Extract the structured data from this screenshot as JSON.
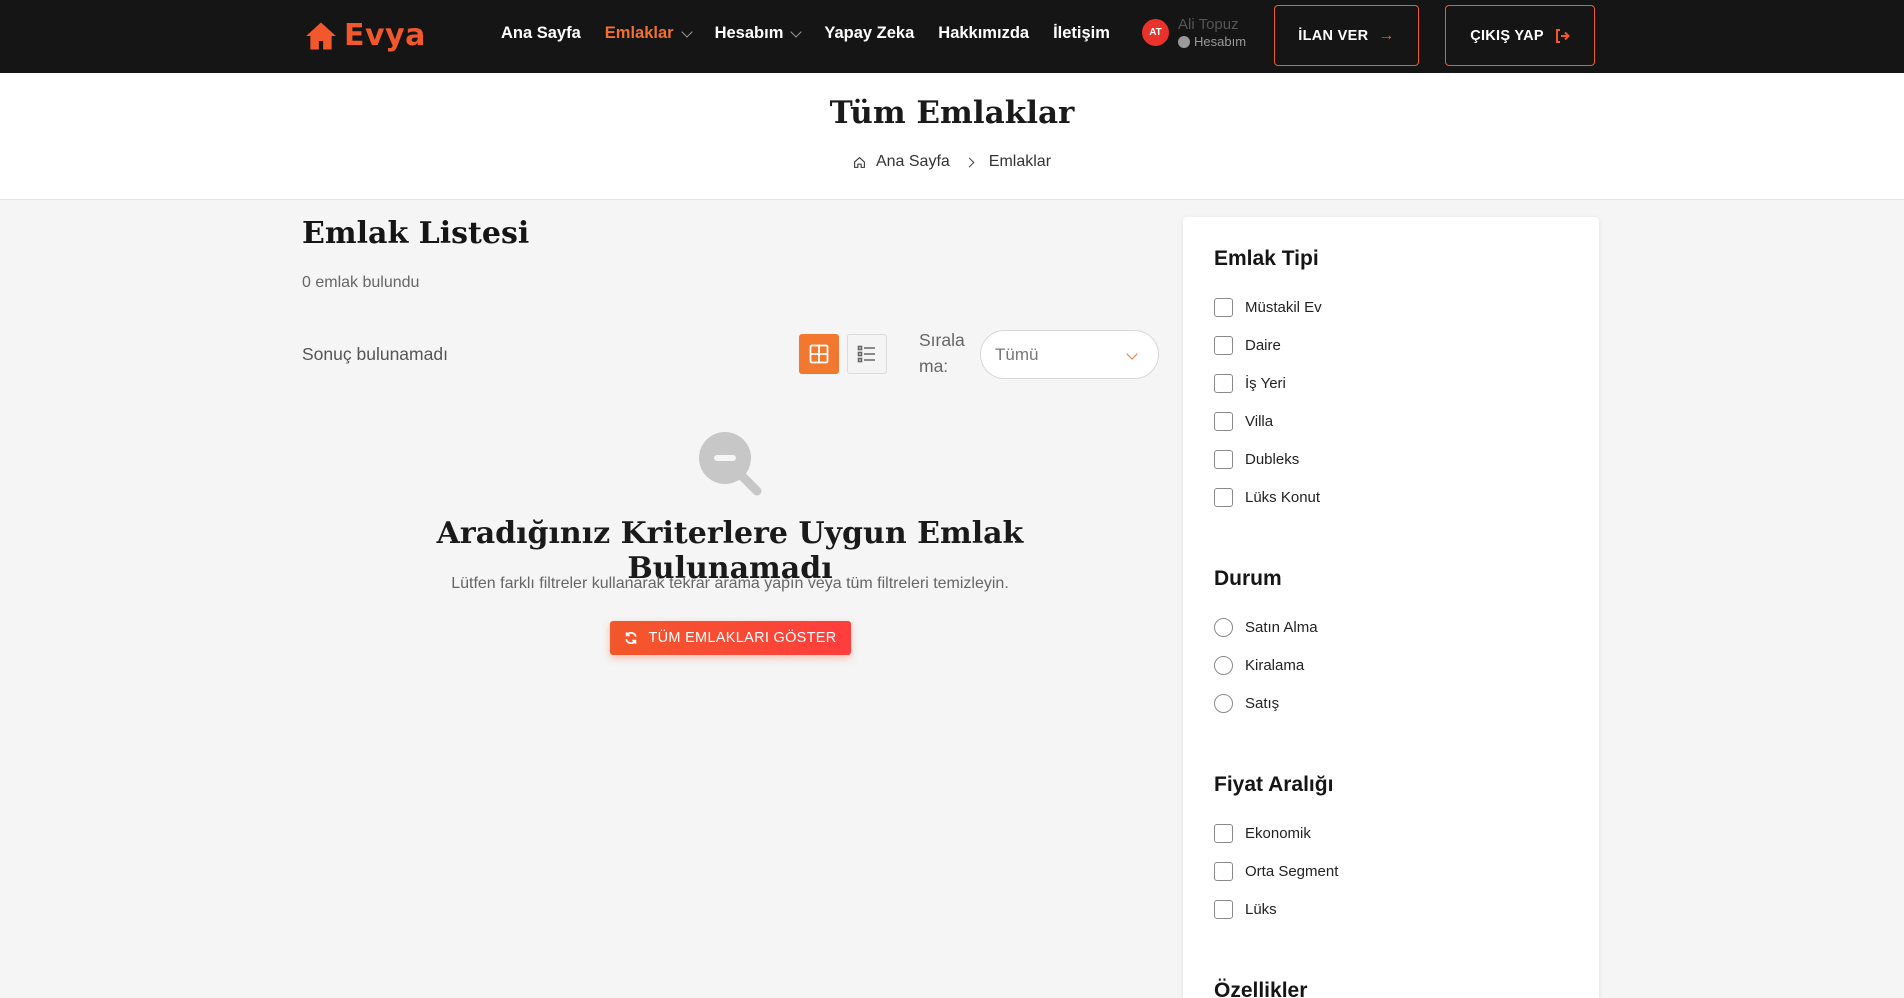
{
  "header": {
    "logo_text": "Evya",
    "nav": [
      {
        "label": "Ana Sayfa"
      },
      {
        "label": "Emlaklar"
      },
      {
        "label": "Hesabım"
      },
      {
        "label": "Yapay Zeka"
      },
      {
        "label": "Hakkımızda"
      },
      {
        "label": "İletişim"
      }
    ],
    "user": {
      "initials": "AT",
      "name": "Ali Topuz",
      "subtitle": "Hesabım"
    },
    "ilan_ver": "İLAN VER",
    "cikis_yap": "ÇIKIŞ YAP"
  },
  "page": {
    "title": "Tüm Emlaklar",
    "breadcrumb": {
      "home": "Ana Sayfa",
      "current": "Emlaklar"
    }
  },
  "listing": {
    "title": "Emlak Listesi",
    "count_text": "0 emlak bulundu",
    "no_result": "Sonuç bulunamadı",
    "sort_label": "Sıralama:",
    "sort_value": "Tümü"
  },
  "empty": {
    "title": "Aradığınız Kriterlere Uygun Emlak Bulunamadı",
    "text": "Lütfen farklı filtreler kullanarak tekrar arama yapın veya tüm filtreleri temizleyin.",
    "button": "TÜM EMLAKLARI GÖSTER"
  },
  "filters": {
    "type": {
      "title": "Emlak Tipi",
      "options": [
        "Müstakil Ev",
        "Daire",
        "İş Yeri",
        "Villa",
        "Dubleks",
        "Lüks Konut"
      ]
    },
    "status": {
      "title": "Durum",
      "options": [
        "Satın Alma",
        "Kiralama",
        "Satış"
      ]
    },
    "price": {
      "title": "Fiyat Aralığı",
      "options": [
        "Ekonomik",
        "Orta Segment",
        "Lüks"
      ]
    },
    "features": {
      "title": "Özellikler"
    }
  },
  "colors": {
    "accent": "#f2582b",
    "header_bg": "#151515",
    "page_bg": "#f5f5f5"
  }
}
